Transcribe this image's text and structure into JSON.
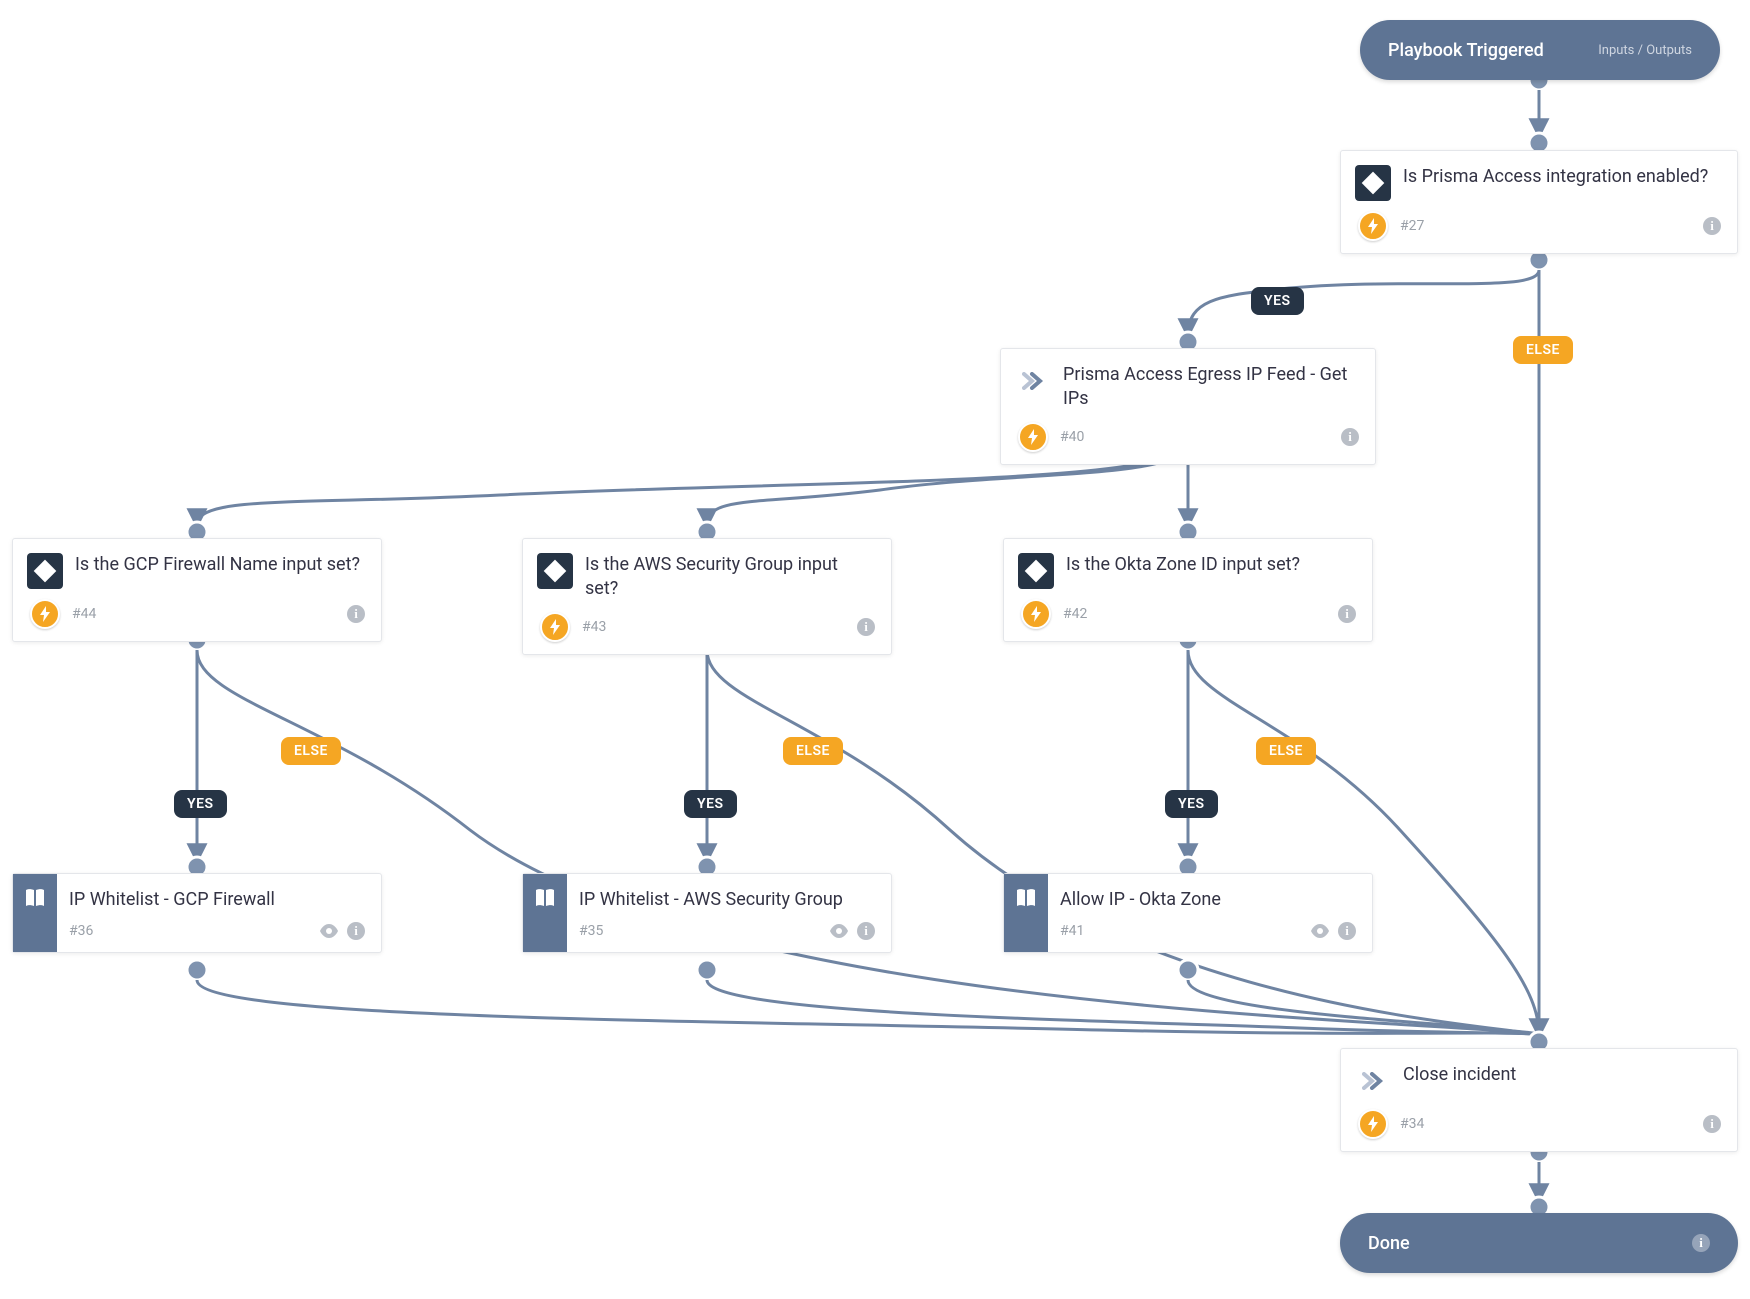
{
  "trigger": {
    "title": "Playbook Triggered",
    "io": "Inputs / Outputs"
  },
  "labels": {
    "yes": "YES",
    "else": "ELSE"
  },
  "done": {
    "label": "Done"
  },
  "nodes": {
    "n27": {
      "title": "Is Prisma Access integration enabled?",
      "num": "#27"
    },
    "n40": {
      "title": "Prisma Access Egress IP Feed - Get IPs",
      "num": "#40"
    },
    "n44": {
      "title": "Is the GCP Firewall Name input set?",
      "num": "#44"
    },
    "n43": {
      "title": "Is the AWS Security Group input set?",
      "num": "#43"
    },
    "n42": {
      "title": "Is the Okta Zone ID input set?",
      "num": "#42"
    },
    "n36": {
      "title": "IP Whitelist - GCP Firewall",
      "num": "#36"
    },
    "n35": {
      "title": "IP Whitelist - AWS Security Group",
      "num": "#35"
    },
    "n41": {
      "title": "Allow IP - Okta Zone",
      "num": "#41"
    },
    "n34": {
      "title": "Close incident",
      "num": "#34"
    }
  }
}
